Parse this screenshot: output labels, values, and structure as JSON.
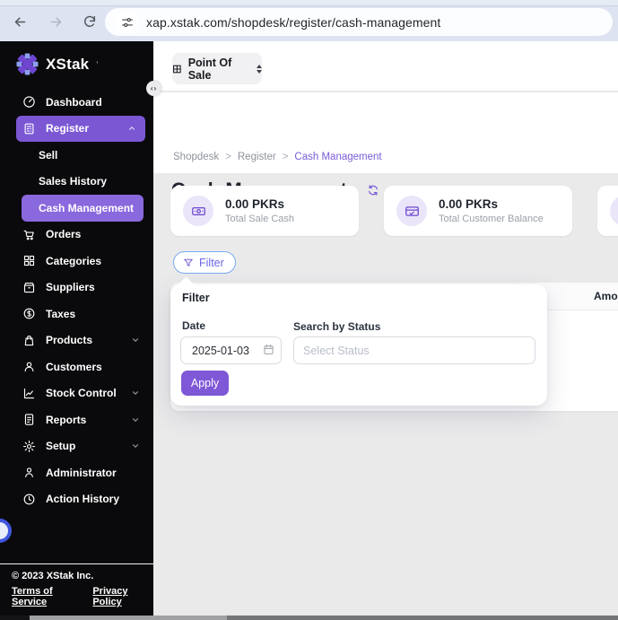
{
  "browser": {
    "url": "xap.xstak.com/shopdesk/register/cash-management"
  },
  "sidebar": {
    "logo_text": "XStak",
    "items": [
      {
        "label": "Dashboard"
      },
      {
        "label": "Register"
      },
      {
        "label": "Sell"
      },
      {
        "label": "Sales History"
      },
      {
        "label": "Cash Management"
      },
      {
        "label": "Orders"
      },
      {
        "label": "Categories"
      },
      {
        "label": "Suppliers"
      },
      {
        "label": "Taxes"
      },
      {
        "label": "Products"
      },
      {
        "label": "Customers"
      },
      {
        "label": "Stock Control"
      },
      {
        "label": "Reports"
      },
      {
        "label": "Setup"
      },
      {
        "label": "Administrator"
      },
      {
        "label": "Action History"
      }
    ],
    "footer": {
      "copyright": "© 2023 XStak Inc.",
      "terms": "Terms of Service",
      "privacy": "Privacy Policy"
    }
  },
  "topbar": {
    "store_selector": "Point Of Sale"
  },
  "breadcrumb": {
    "items": [
      "Shopdesk",
      "Register",
      "Cash Management"
    ],
    "separator": ">"
  },
  "page": {
    "title": "Cash Management"
  },
  "summary_cards": [
    {
      "value": "0.00 PKRs",
      "label": "Total Sale Cash"
    },
    {
      "value": "0.00 PKRs",
      "label": "Total Customer Balance"
    }
  ],
  "filter": {
    "button_label": "Filter",
    "panel_title": "Filter",
    "date_label": "Date",
    "date_value": "2025-01-03",
    "status_label": "Search by Status",
    "status_placeholder": "Select Status",
    "apply_label": "Apply"
  },
  "table": {
    "columns": [
      "Amount"
    ]
  },
  "icons": {
    "collapse": "‹›"
  },
  "colors": {
    "accent_purple": "#7c5cd6",
    "sidebar_active": "#7b57d4",
    "submenu_active": "#8a68dd",
    "filter_border": "#79aaf3",
    "apply_bg": "#7e58d6"
  }
}
